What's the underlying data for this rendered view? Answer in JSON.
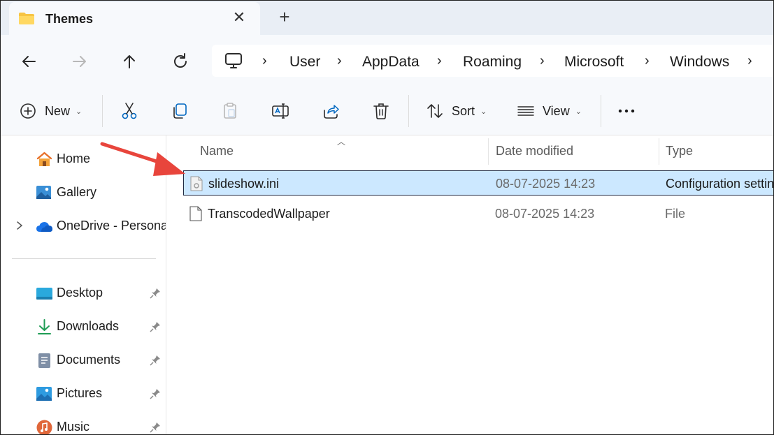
{
  "tab": {
    "title": "Themes",
    "close_icon": "close-icon",
    "new_tab_icon": "plus-icon"
  },
  "nav": {
    "back_icon": "arrow-left-icon",
    "forward_icon": "arrow-right-icon",
    "up_icon": "arrow-up-icon",
    "refresh_icon": "refresh-icon"
  },
  "breadcrumb": [
    "User",
    "AppData",
    "Roaming",
    "Microsoft",
    "Windows"
  ],
  "toolbar": {
    "new_label": "New",
    "sort_label": "Sort",
    "view_label": "View"
  },
  "sidebar": {
    "items": [
      {
        "label": "Home",
        "icon": "home-icon"
      },
      {
        "label": "Gallery",
        "icon": "gallery-icon"
      },
      {
        "label": "OneDrive - Persona",
        "icon": "onedrive-icon"
      },
      {
        "label": "Desktop",
        "icon": "desktop-icon"
      },
      {
        "label": "Downloads",
        "icon": "downloads-icon"
      },
      {
        "label": "Documents",
        "icon": "documents-icon"
      },
      {
        "label": "Pictures",
        "icon": "pictures-icon"
      },
      {
        "label": "Music",
        "icon": "music-icon"
      }
    ]
  },
  "columns": {
    "name": "Name",
    "date": "Date modified",
    "type": "Type"
  },
  "files": [
    {
      "name": "slideshow.ini",
      "date": "08-07-2025 14:23",
      "type": "Configuration settin",
      "selected": true
    },
    {
      "name": "TranscodedWallpaper",
      "date": "08-07-2025 14:23",
      "type": "File",
      "selected": false
    }
  ],
  "colors": {
    "accent": "#0067c0",
    "selection": "#cce8ff",
    "annotation_arrow": "#e8453c"
  }
}
